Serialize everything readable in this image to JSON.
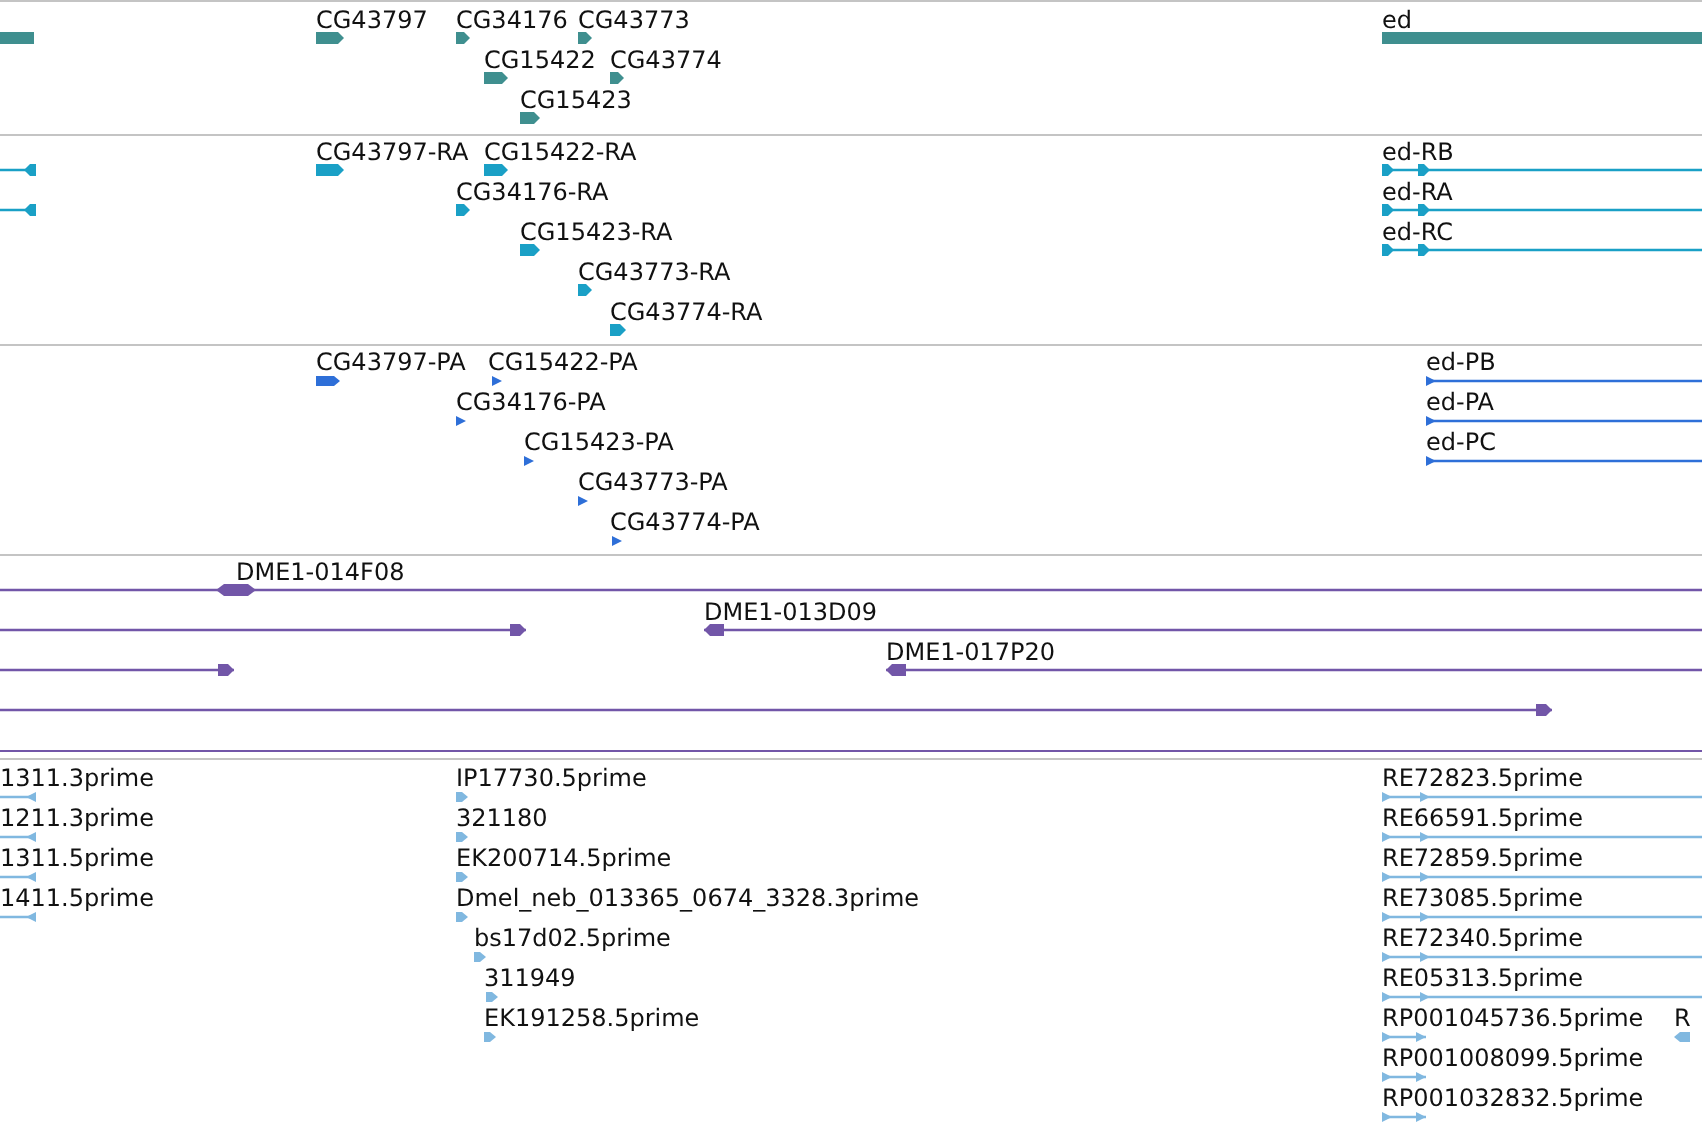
{
  "tracks": [
    {
      "kind": "gene",
      "color": "#3f8f8f",
      "features": [
        {
          "forward": false,
          "reverse": false
        },
        {
          "label": "CG43797",
          "forward": true,
          "reverse": false
        },
        {
          "label": "CG34176",
          "forward": true,
          "reverse": false
        },
        {
          "label": "CG43773",
          "forward": true,
          "reverse": false
        },
        {
          "label": "ed",
          "forward": false,
          "reverse": false
        },
        {
          "label": "CG15422",
          "forward": true,
          "reverse": false
        },
        {
          "label": "CG43774",
          "forward": true,
          "reverse": false
        },
        {
          "label": "CG15423",
          "forward": true,
          "reverse": false
        }
      ]
    },
    {
      "kind": "transcript",
      "color": "#1aa0c6",
      "features": [
        {
          "forward": false,
          "reverse": true
        },
        {
          "label": "CG43797-RA",
          "forward": true,
          "reverse": false
        },
        {
          "label": "CG15422-RA",
          "forward": true,
          "reverse": false
        },
        {
          "label": "ed-RB",
          "forward": true,
          "reverse": false
        },
        {
          "forward": false,
          "reverse": true
        },
        {
          "label": "CG34176-RA",
          "forward": true,
          "reverse": false
        },
        {
          "label": "ed-RA",
          "forward": true,
          "reverse": false
        },
        {
          "label": "CG15423-RA",
          "forward": true,
          "reverse": false
        },
        {
          "label": "ed-RC",
          "forward": true,
          "reverse": false
        },
        {
          "label": "CG43773-RA",
          "forward": true,
          "reverse": false
        },
        {
          "label": "CG43774-RA",
          "forward": true,
          "reverse": false
        }
      ]
    },
    {
      "kind": "protein",
      "color": "#2e6fd8",
      "features": [
        {
          "label": "CG43797-PA",
          "forward": true,
          "reverse": false
        },
        {
          "label": "CG15422-PA",
          "forward": true,
          "reverse": false
        },
        {
          "label": "ed-PB",
          "forward": true,
          "reverse": false
        },
        {
          "label": "CG34176-PA",
          "forward": true,
          "reverse": false
        },
        {
          "label": "ed-PA",
          "forward": true,
          "reverse": false
        },
        {
          "label": "CG15423-PA",
          "forward": true,
          "reverse": false
        },
        {
          "label": "ed-PC",
          "forward": true,
          "reverse": false
        },
        {
          "label": "CG43773-PA",
          "forward": true,
          "reverse": false
        },
        {
          "label": "CG43774-PA",
          "forward": true,
          "reverse": false
        }
      ]
    },
    {
      "kind": "clone",
      "color": "#7256a8",
      "features": [
        {
          "label": "DME1-014F08",
          "forward": true,
          "reverse": true
        },
        {
          "forward": true,
          "reverse": false
        },
        {
          "label": "DME1-013D09",
          "forward": false,
          "reverse": true
        },
        {
          "forward": true,
          "reverse": false
        },
        {
          "label": "DME1-017P20",
          "forward": false,
          "reverse": true
        },
        {
          "forward": true,
          "reverse": false
        }
      ]
    },
    {
      "kind": "est",
      "color": "#80b8e0",
      "features": [
        {
          "label": "1311.3prime",
          "forward": false,
          "reverse": true
        },
        {
          "label": "IP17730.5prime",
          "forward": true,
          "reverse": false
        },
        {
          "label": "RE72823.5prime",
          "forward": true,
          "reverse": false
        },
        {
          "label": "1211.3prime",
          "forward": false,
          "reverse": true
        },
        {
          "label": "321180",
          "forward": true,
          "reverse": false
        },
        {
          "label": "RE66591.5prime",
          "forward": true,
          "reverse": false
        },
        {
          "label": "1311.5prime",
          "forward": false,
          "reverse": true
        },
        {
          "label": "EK200714.5prime",
          "forward": true,
          "reverse": false
        },
        {
          "label": "RE72859.5prime",
          "forward": true,
          "reverse": false
        },
        {
          "label": "1411.5prime",
          "forward": false,
          "reverse": true
        },
        {
          "label": "Dmel_neb_013365_0674_3328.3prime",
          "forward": true,
          "reverse": false
        },
        {
          "label": "RE73085.5prime",
          "forward": true,
          "reverse": false
        },
        {
          "label": "bs17d02.5prime",
          "forward": true,
          "reverse": false
        },
        {
          "label": "RE72340.5prime",
          "forward": true,
          "reverse": false
        },
        {
          "label": "311949",
          "forward": true,
          "reverse": false
        },
        {
          "label": "RE05313.5prime",
          "forward": true,
          "reverse": false
        },
        {
          "label": "EK191258.5prime",
          "forward": true,
          "reverse": false
        },
        {
          "label": "RP001045736.5prime",
          "forward": true,
          "reverse": false
        },
        {
          "label": "R",
          "forward": false,
          "reverse": true
        },
        {
          "label": "RP001008099.5prime",
          "forward": true,
          "reverse": false
        },
        {
          "label": "RP001032832.5prime",
          "forward": true,
          "reverse": false
        }
      ]
    }
  ]
}
